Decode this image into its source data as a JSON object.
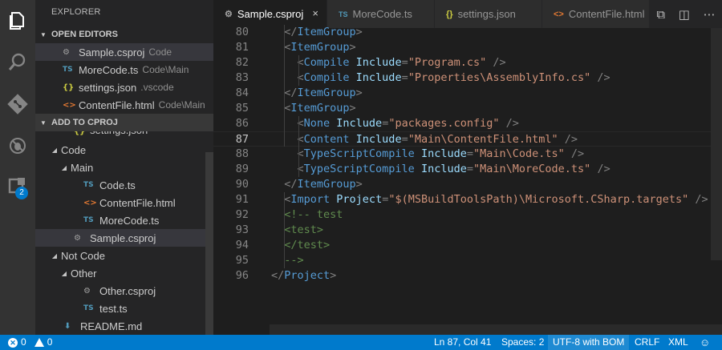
{
  "sidebar": {
    "title": "EXPLORER",
    "open_editors": {
      "header": "OPEN EDITORS",
      "items": [
        {
          "icon": "gear-icon",
          "name": "Sample.csproj",
          "desc": "Code",
          "selected": true
        },
        {
          "icon": "ts-file-icon",
          "name": "MoreCode.ts",
          "desc": "Code\\Main"
        },
        {
          "icon": "json-file-icon",
          "name": "settings.json",
          "desc": ".vscode"
        },
        {
          "icon": "html-file-icon",
          "name": "ContentFile.html",
          "desc": "Code\\Main"
        }
      ]
    },
    "project": {
      "header": "ADD TO CPROJ",
      "partial_item": "settings.json",
      "tree": [
        {
          "label": "Code"
        },
        {
          "label": "Main"
        },
        {
          "label": "Code.ts"
        },
        {
          "label": "ContentFile.html"
        },
        {
          "label": "MoreCode.ts"
        },
        {
          "label": "Sample.csproj"
        },
        {
          "label": "Not Code"
        },
        {
          "label": "Other"
        },
        {
          "label": "Other.csproj"
        },
        {
          "label": "test.ts"
        },
        {
          "label": "README.md"
        }
      ]
    }
  },
  "activity": {
    "extensions_badge": "2"
  },
  "tabs": [
    {
      "label": "Sample.csproj",
      "icon_text": "⚙",
      "active": true,
      "close": "×"
    },
    {
      "label": "MoreCode.ts",
      "icon_text": "TS"
    },
    {
      "label": "settings.json",
      "icon_text": "{}"
    },
    {
      "label": "ContentFile.html",
      "icon_text": "<>"
    }
  ],
  "editor": {
    "current_line": "87",
    "lines": [
      {
        "n": "80",
        "t": [
          [
            "punc",
            "  </"
          ],
          [
            "tag",
            "ItemGroup"
          ],
          [
            "punc",
            ">"
          ]
        ]
      },
      {
        "n": "81",
        "t": [
          [
            "punc",
            "  <"
          ],
          [
            "tag",
            "ItemGroup"
          ],
          [
            "punc",
            ">"
          ]
        ]
      },
      {
        "n": "82",
        "t": [
          [
            "punc",
            "    <"
          ],
          [
            "tag",
            "Compile "
          ],
          [
            "attr",
            "Include"
          ],
          [
            "punc",
            "="
          ],
          [
            "str",
            "\"Program.cs\""
          ],
          [
            "punc",
            " />"
          ]
        ]
      },
      {
        "n": "83",
        "t": [
          [
            "punc",
            "    <"
          ],
          [
            "tag",
            "Compile "
          ],
          [
            "attr",
            "Include"
          ],
          [
            "punc",
            "="
          ],
          [
            "str",
            "\"Properties\\AssemblyInfo.cs\""
          ],
          [
            "punc",
            " />"
          ]
        ]
      },
      {
        "n": "84",
        "t": [
          [
            "punc",
            "  </"
          ],
          [
            "tag",
            "ItemGroup"
          ],
          [
            "punc",
            ">"
          ]
        ]
      },
      {
        "n": "85",
        "t": [
          [
            "punc",
            "  <"
          ],
          [
            "tag",
            "ItemGroup"
          ],
          [
            "punc",
            ">"
          ]
        ]
      },
      {
        "n": "86",
        "t": [
          [
            "punc",
            "    <"
          ],
          [
            "tag",
            "None "
          ],
          [
            "attr",
            "Include"
          ],
          [
            "punc",
            "="
          ],
          [
            "str",
            "\"packages.config\""
          ],
          [
            "punc",
            " />"
          ]
        ]
      },
      {
        "n": "87",
        "t": [
          [
            "punc",
            "    <"
          ],
          [
            "tag",
            "Content "
          ],
          [
            "attr",
            "Include"
          ],
          [
            "punc",
            "="
          ],
          [
            "str",
            "\"Main\\ContentFile.html\""
          ],
          [
            "punc",
            " />"
          ]
        ]
      },
      {
        "n": "88",
        "t": [
          [
            "punc",
            "    <"
          ],
          [
            "tag",
            "TypeScriptCompile "
          ],
          [
            "attr",
            "Include"
          ],
          [
            "punc",
            "="
          ],
          [
            "str",
            "\"Main\\Code.ts\""
          ],
          [
            "punc",
            " />"
          ]
        ]
      },
      {
        "n": "89",
        "t": [
          [
            "punc",
            "    <"
          ],
          [
            "tag",
            "TypeScriptCompile "
          ],
          [
            "attr",
            "Include"
          ],
          [
            "punc",
            "="
          ],
          [
            "str",
            "\"Main\\MoreCode.ts\""
          ],
          [
            "punc",
            " />"
          ]
        ]
      },
      {
        "n": "90",
        "t": [
          [
            "punc",
            "  </"
          ],
          [
            "tag",
            "ItemGroup"
          ],
          [
            "punc",
            ">"
          ]
        ]
      },
      {
        "n": "91",
        "t": [
          [
            "punc",
            "  <"
          ],
          [
            "tag",
            "Import "
          ],
          [
            "attr",
            "Project"
          ],
          [
            "punc",
            "="
          ],
          [
            "str",
            "\"$(MSBuildToolsPath)\\Microsoft.CSharp.targets\""
          ],
          [
            "punc",
            " />"
          ]
        ]
      },
      {
        "n": "92",
        "t": [
          [
            "cmt",
            "  <!-- test"
          ]
        ]
      },
      {
        "n": "93",
        "t": [
          [
            "cmt",
            "  <test>"
          ]
        ]
      },
      {
        "n": "94",
        "t": [
          [
            "cmt",
            "  </test>"
          ]
        ]
      },
      {
        "n": "95",
        "t": [
          [
            "cmt",
            "  -->"
          ]
        ]
      },
      {
        "n": "96",
        "t": [
          [
            "punc",
            "</"
          ],
          [
            "tag",
            "Project"
          ],
          [
            "punc",
            ">"
          ]
        ]
      }
    ]
  },
  "status": {
    "errors": "0",
    "warnings": "0",
    "position": "Ln 87, Col 41",
    "spaces": "Spaces: 2",
    "encoding": "UTF-8 with BOM",
    "eol": "CRLF",
    "language": "XML"
  },
  "colors": {
    "accent": "#007acc",
    "tag": "#569cd6",
    "attribute": "#9cdcfe",
    "string": "#ce9178",
    "comment": "#608b4e"
  }
}
